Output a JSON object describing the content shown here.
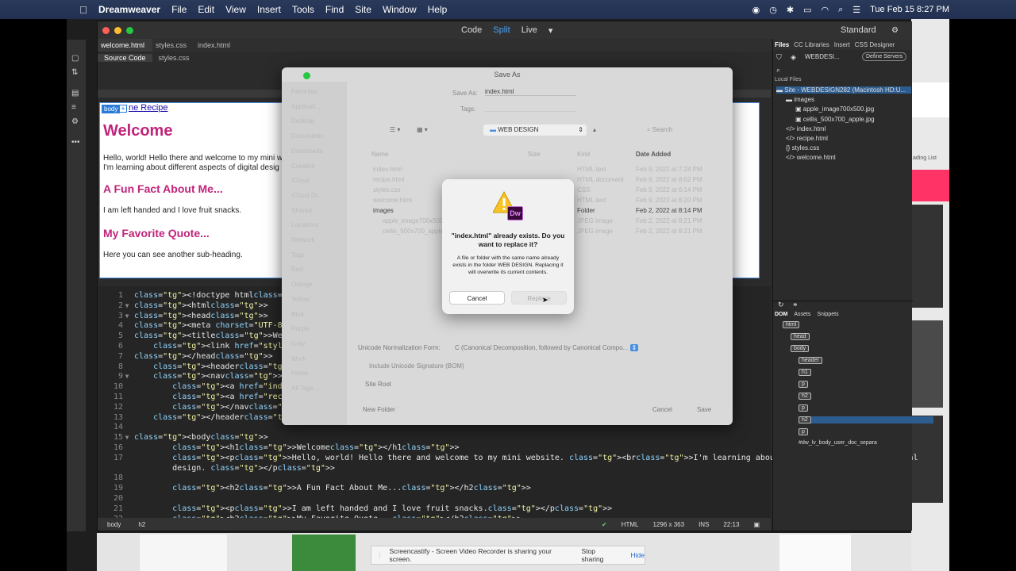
{
  "menubar": {
    "app": "Dreamweaver",
    "items": [
      "File",
      "Edit",
      "View",
      "Insert",
      "Tools",
      "Find",
      "Site",
      "Window",
      "Help"
    ],
    "clock": "Tue Feb 15  8:27 PM"
  },
  "window": {
    "modes": [
      "Code",
      "Split",
      "Live"
    ],
    "active_mode": "Split",
    "workspace": "Standard",
    "tabs": [
      "welcome.html",
      "styles.css",
      "index.html"
    ],
    "subtabs": [
      "Source Code",
      "styles.css"
    ]
  },
  "liveview": {
    "body_tag": "body",
    "nav_link": "ne Recipe",
    "h1": "Welcome",
    "p1_line1": "Hello, world! Hello there and welcome to my mini w",
    "p1_line2": "I'm learning about different aspects of digital desig",
    "h2a": "A Fun Fact About Me...",
    "p2": "I am left handed and I love fruit snacks.",
    "h2b": "My Favorite Quote...",
    "p3": "Here you can see another sub-heading."
  },
  "code_lines": [
    {
      "n": "1",
      "t": "<!doctype html>"
    },
    {
      "n": "2",
      "t": "<html>"
    },
    {
      "n": "3",
      "t": "<head>"
    },
    {
      "n": "4",
      "t": "<meta charset=\"UTF-8\">"
    },
    {
      "n": "5",
      "t": "<title>Welcome</title>"
    },
    {
      "n": "6",
      "t": "    <link href=\"styles.css\" ty"
    },
    {
      "n": "7",
      "t": "</head>"
    },
    {
      "n": "8",
      "t": "    <header>"
    },
    {
      "n": "9",
      "t": "    <nav>"
    },
    {
      "n": "10",
      "t": "        <a href=\"index.html\">We"
    },
    {
      "n": "11",
      "t": "        <a href=\"recipe.html\">R"
    },
    {
      "n": "12",
      "t": "        </nav>"
    },
    {
      "n": "13",
      "t": "    </header>"
    },
    {
      "n": "14",
      "t": ""
    },
    {
      "n": "15",
      "t": "<body>"
    },
    {
      "n": "16",
      "t": "        <h1>Welcome</h1>"
    },
    {
      "n": "17",
      "t": "        <p>Hello, world! Hello there and welcome to my mini website. <br>I'm learning about different aspects of digital"
    },
    {
      "n": "",
      "t": "        design. </p>"
    },
    {
      "n": "18",
      "t": ""
    },
    {
      "n": "19",
      "t": "        <h2>A Fun Fact About Me...</h2>"
    },
    {
      "n": "20",
      "t": ""
    },
    {
      "n": "21",
      "t": "        <p>I am left handed and I love fruit snacks.</p>"
    },
    {
      "n": "22",
      "t": "        <h2>My Favorite Quote...</h2>"
    }
  ],
  "status": {
    "crumbs": [
      "body",
      "h2"
    ],
    "lang": "HTML",
    "size": "1296 x 363",
    "mode": "INS",
    "pos": "22:13"
  },
  "rpanel": {
    "tabs": [
      "Files",
      "CC Libraries",
      "Insert",
      "CSS Designer"
    ],
    "site_select": "WEBDESI...",
    "define_servers": "Define Servers",
    "local_files": "Local Files",
    "tree": [
      {
        "label": "Site - WEBDESIGN282 (Macintosh HD:U...",
        "indent": 0,
        "sel": true
      },
      {
        "label": "images",
        "indent": 1
      },
      {
        "label": "apple_image700x500.jpg",
        "indent": 2
      },
      {
        "label": "cellis_500x700_apple.jpg",
        "indent": 2
      },
      {
        "label": "index.html",
        "indent": 1
      },
      {
        "label": "recipe.html",
        "indent": 1
      },
      {
        "label": "styles.css",
        "indent": 1
      },
      {
        "label": "welcome.html",
        "indent": 1
      }
    ],
    "dom_tabs": [
      "DOM",
      "Assets",
      "Snippets"
    ],
    "dom": [
      {
        "label": "html",
        "indent": 0
      },
      {
        "label": "head",
        "indent": 1
      },
      {
        "label": "body",
        "indent": 1
      },
      {
        "label": "header",
        "indent": 2
      },
      {
        "label": "h1",
        "indent": 2
      },
      {
        "label": "p",
        "indent": 2
      },
      {
        "label": "h2",
        "indent": 2
      },
      {
        "label": "p",
        "indent": 2
      },
      {
        "label": "h2",
        "indent": 2,
        "sel": true
      },
      {
        "label": "p",
        "indent": 2
      },
      {
        "label": "#dw_lv_body_user_doc_separa",
        "indent": 2
      }
    ]
  },
  "saveas": {
    "title": "Save As",
    "save_as_label": "Save As:",
    "save_as_value": "index.html",
    "tags_label": "Tags:",
    "folder": "WEB DESIGN",
    "search_placeholder": "Search",
    "col_name": "Name",
    "col_size": "Size",
    "col_kind": "Kind",
    "col_date": "Date Added",
    "rows": [
      {
        "name": "index.html",
        "size": "",
        "kind": "HTML text",
        "date": "Feb 9, 2022 at 7:24 PM"
      },
      {
        "name": "recipe.html",
        "size": "",
        "kind": "HTML document",
        "date": "Feb 9, 2022 at 8:02 PM"
      },
      {
        "name": "styles.css",
        "size": "",
        "kind": "CSS",
        "date": "Feb 9, 2022 at 6:14 PM"
      },
      {
        "name": "welcome.html",
        "size": "",
        "kind": "HTML text",
        "date": "Feb 9, 2022 at 6:20 PM"
      },
      {
        "name": "images",
        "size": "",
        "kind": "Folder",
        "date": "Feb 2, 2022 at 8:14 PM"
      },
      {
        "name": "apple_image700x500.jpg",
        "size": "",
        "kind": "JPEG image",
        "date": "Feb 2, 2022 at 8:21 PM"
      },
      {
        "name": "cellis_500x700_apple.jpg",
        "size": "",
        "kind": "JPEG image",
        "date": "Feb 2, 2022 at 8:21 PM"
      }
    ],
    "sidebar": [
      "Favorites",
      "Applicati...",
      "Desktop",
      "Documents",
      "Downloads",
      "Creative",
      "iCloud",
      "iCloud Dr...",
      "Shared",
      "Locations",
      "Network",
      "Tags",
      "Red",
      "Orange",
      "Yellow",
      "Blue",
      "Purple",
      "Gray",
      "Work",
      "Home",
      "All Tags..."
    ],
    "unicode_label": "Unicode Normalization Form:",
    "unicode_value": "C (Canonical Decomposition, followed by Canonical Compo...",
    "bom_label": "Include Unicode Signature (BOM)",
    "site_root": "Site Root",
    "new_folder": "New Folder",
    "cancel": "Cancel",
    "save": "Save"
  },
  "alert": {
    "badge": "Dw",
    "title": "\"index.html\" already exists. Do you want to replace it?",
    "message": "A file or folder with the same name already exists in the folder WEB DESIGN. Replacing it will overwrite its current contents.",
    "cancel": "Cancel",
    "replace": "Replace"
  },
  "sharing": {
    "text": "Screencastify - Screen Video Recorder is sharing your screen.",
    "stop": "Stop sharing",
    "hide": "Hide"
  },
  "colors": {
    "accent": "#4aa3ff",
    "heading": "#c0247a",
    "selected": "#2d5c8e"
  }
}
